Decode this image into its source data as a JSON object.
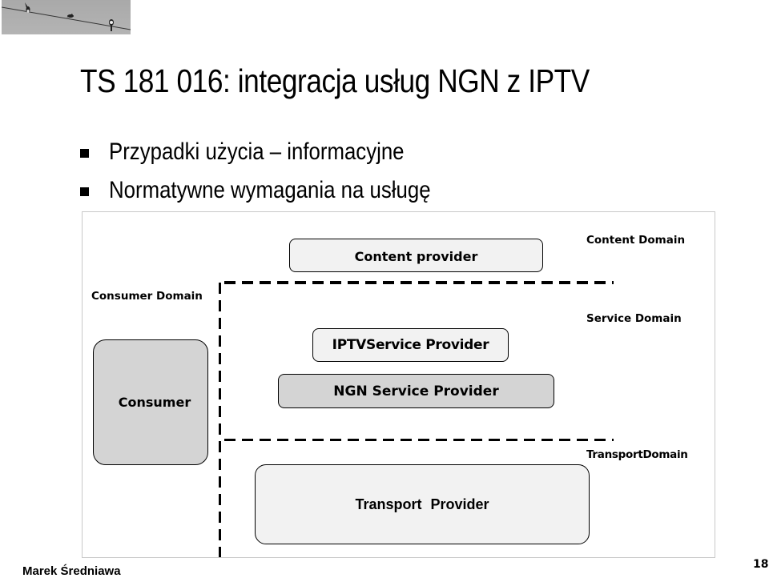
{
  "header": {
    "decorative_image": "photo of swallows perched on a wire"
  },
  "slide": {
    "title": "TS 181 016: integracja usług NGN z IPTV",
    "bullets": [
      "Przypadki użycia – informacyjne",
      "Normatywne wymagania na usługę"
    ]
  },
  "diagram": {
    "domains": {
      "content": "Content Domain",
      "consumer": "Consumer Domain",
      "service": "Service Domain",
      "transport": "TransportDomain"
    },
    "boxes": {
      "content_provider": "Content provider",
      "iptv_service_provider": "IPTVService Provider",
      "ngn_service_provider": "NGN Service Provider",
      "consumer": "Consumer",
      "transport_provider": "Transport  Provider"
    },
    "colors": {
      "light_box": "#f2f2f2",
      "gray_box": "#d4d4d4",
      "frame": "#c8c8c8"
    }
  },
  "footer": {
    "author": "Marek Średniawa",
    "page_number": "18"
  }
}
